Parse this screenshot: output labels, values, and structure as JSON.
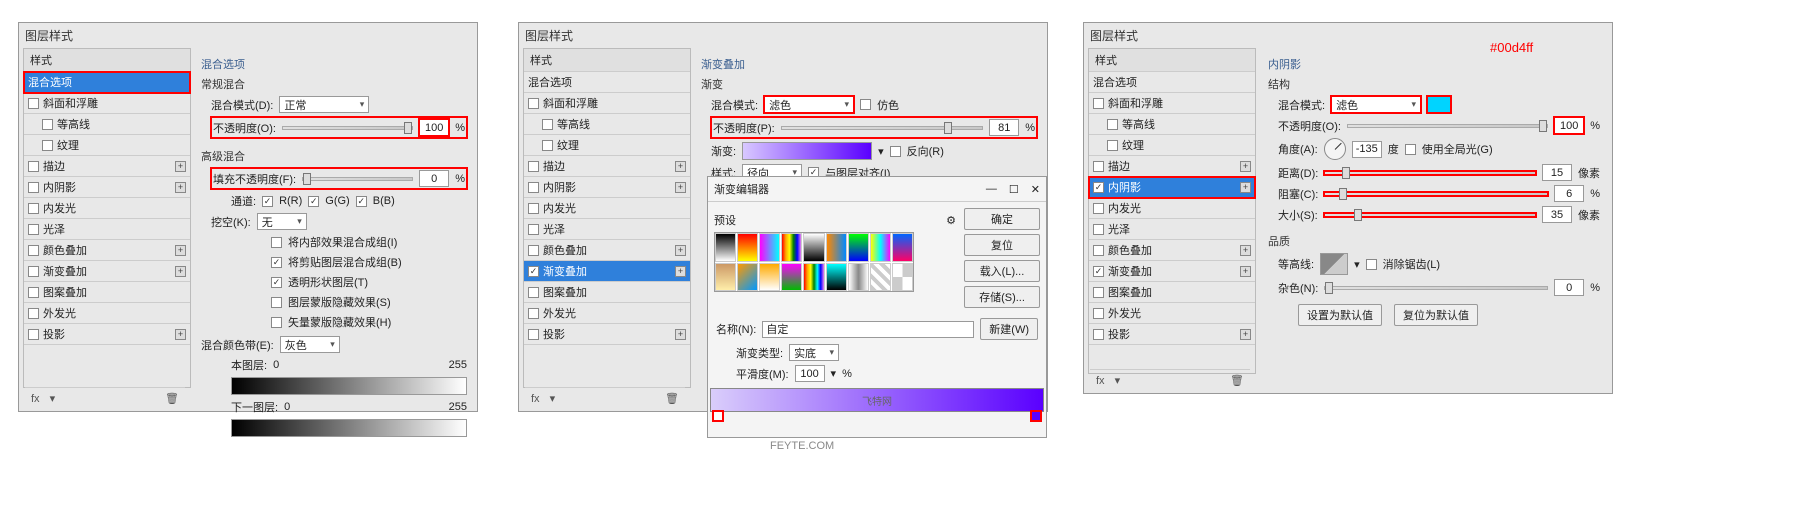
{
  "panel1": {
    "title": "图层样式",
    "style_header": "样式",
    "items": [
      {
        "label": "混合选项",
        "selected": true,
        "red": true
      },
      {
        "label": "斜面和浮雕",
        "chk": true
      },
      {
        "label": "等高线",
        "indent": true,
        "chk": true
      },
      {
        "label": "纹理",
        "indent": true,
        "chk": true
      },
      {
        "label": "描边",
        "chk": true,
        "plus": true
      },
      {
        "label": "内阴影",
        "chk": true,
        "plus": true
      },
      {
        "label": "内发光",
        "chk": true
      },
      {
        "label": "光泽",
        "chk": true
      },
      {
        "label": "颜色叠加",
        "chk": true,
        "plus": true
      },
      {
        "label": "渐变叠加",
        "chk": true,
        "plus": true
      },
      {
        "label": "图案叠加",
        "chk": true
      },
      {
        "label": "外发光",
        "chk": true
      },
      {
        "label": "投影",
        "chk": true,
        "plus": true
      }
    ],
    "footer": "fx",
    "options": {
      "title": "混合选项",
      "normal_blend": "常规混合",
      "blend_mode_label": "混合模式(D):",
      "blend_mode_value": "正常",
      "opacity_label": "不透明度(O):",
      "opacity_value": "100",
      "percent": "%",
      "adv_blend": "高级混合",
      "fill_opacity_label": "填充不透明度(F):",
      "fill_opacity_value": "0",
      "channels_label": "通道:",
      "channel_r": "R(R)",
      "channel_g": "G(G)",
      "channel_b": "B(B)",
      "knockout_label": "挖空(K):",
      "knockout_value": "无",
      "chk1": "将内部效果混合成组(I)",
      "chk2": "将剪贴图层混合成组(B)",
      "chk3": "透明形状图层(T)",
      "chk4": "图层蒙版隐藏效果(S)",
      "chk5": "矢量蒙版隐藏效果(H)",
      "blend_if_label": "混合颜色带(E):",
      "blend_if_value": "灰色",
      "this_layer": "本图层:",
      "under_layer": "下一图层:",
      "range0": "0",
      "range255": "255"
    }
  },
  "panel2": {
    "title": "图层样式",
    "style_header": "样式",
    "items": [
      {
        "label": "混合选项"
      },
      {
        "label": "斜面和浮雕",
        "chk": true
      },
      {
        "label": "等高线",
        "indent": true,
        "chk": true
      },
      {
        "label": "纹理",
        "indent": true,
        "chk": true
      },
      {
        "label": "描边",
        "chk": true,
        "plus": true
      },
      {
        "label": "内阴影",
        "chk": true,
        "plus": true
      },
      {
        "label": "内发光",
        "chk": true
      },
      {
        "label": "光泽",
        "chk": true
      },
      {
        "label": "颜色叠加",
        "chk": true,
        "plus": true
      },
      {
        "label": "渐变叠加",
        "chk": true,
        "plus": true,
        "selected": true,
        "checked": true
      },
      {
        "label": "图案叠加",
        "chk": true
      },
      {
        "label": "外发光",
        "chk": true
      },
      {
        "label": "投影",
        "chk": true,
        "plus": true
      }
    ],
    "footer": "fx",
    "gradoverlay": {
      "title": "渐变叠加",
      "group": "渐变",
      "blend_mode_label": "混合模式:",
      "blend_mode_value": "滤色",
      "dither_label": "仿色",
      "opacity_label": "不透明度(P):",
      "opacity_value": "81",
      "percent": "%",
      "grad_label": "渐变:",
      "reverse_label": "反向(R)",
      "style_label": "样式:",
      "style_value": "径向",
      "align_label": "与图层对齐(I)"
    },
    "editor": {
      "title": "渐变编辑器",
      "presets": "预设",
      "ok": "确定",
      "reset": "复位",
      "load": "载入(L)...",
      "save": "存储(S)...",
      "name_label": "名称(N):",
      "name_value": "自定",
      "new_btn": "新建(W)",
      "gtype_label": "渐变类型:",
      "gtype_value": "实底",
      "smooth_label": "平滑度(M):",
      "smooth_value": "100",
      "percent": "%",
      "watermark": "飞特网",
      "footer": "FEYTE.COM"
    }
  },
  "panel3": {
    "title": "图层样式",
    "style_header": "样式",
    "items": [
      {
        "label": "混合选项"
      },
      {
        "label": "斜面和浮雕",
        "chk": true
      },
      {
        "label": "等高线",
        "indent": true,
        "chk": true
      },
      {
        "label": "纹理",
        "indent": true,
        "chk": true
      },
      {
        "label": "描边",
        "chk": true,
        "plus": true
      },
      {
        "label": "内阴影",
        "chk": true,
        "plus": true,
        "selected": true,
        "checked": true,
        "red": true
      },
      {
        "label": "内发光",
        "chk": true
      },
      {
        "label": "光泽",
        "chk": true
      },
      {
        "label": "颜色叠加",
        "chk": true,
        "plus": true
      },
      {
        "label": "渐变叠加",
        "chk": true,
        "plus": true,
        "checked": true
      },
      {
        "label": "图案叠加",
        "chk": true
      },
      {
        "label": "外发光",
        "chk": true
      },
      {
        "label": "投影",
        "chk": true,
        "plus": true
      }
    ],
    "footer": "fx",
    "innershadow": {
      "title": "内阴影",
      "struct": "结构",
      "blend_mode_label": "混合模式:",
      "blend_mode_value": "滤色",
      "opacity_label": "不透明度(O):",
      "opacity_value": "100",
      "percent": "%",
      "angle_label": "角度(A):",
      "angle_value": "-135",
      "deg": "度",
      "global_label": "使用全局光(G)",
      "distance_label": "距离(D):",
      "distance_value": "15",
      "px": "像素",
      "choke_label": "阻塞(C):",
      "choke_value": "6",
      "size_label": "大小(S):",
      "size_value": "35",
      "quality": "品质",
      "contour_label": "等高线:",
      "anti_label": "消除锯齿(L)",
      "noise_label": "杂色(N):",
      "noise_value": "0",
      "make_default": "设置为默认值",
      "reset_default": "复位为默认值"
    }
  },
  "annotations": {
    "color1": "#00d4ff",
    "color2": "#5a00ff"
  }
}
